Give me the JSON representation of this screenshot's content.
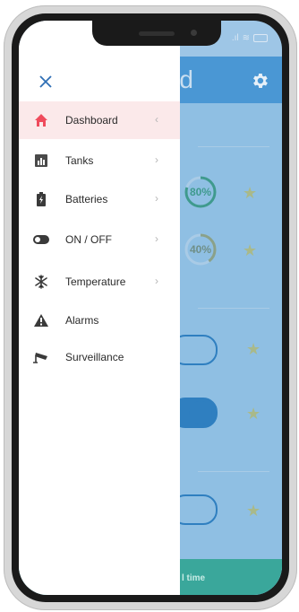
{
  "header": {
    "title_fragment": "rd"
  },
  "readings": [
    {
      "value_text": "80%",
      "percent": 80
    },
    {
      "value_text": "40%",
      "percent": 40
    }
  ],
  "toggles": [
    {
      "on": false
    },
    {
      "on": true
    },
    {
      "on": false
    }
  ],
  "bottom": {
    "text_fragment": "l time"
  },
  "drawer": {
    "close_icon": "close-icon",
    "items": [
      {
        "label": "Dashboard",
        "icon": "home-icon",
        "active": true,
        "chevron": "‹"
      },
      {
        "label": "Tanks",
        "icon": "bar-chart-icon",
        "chevron": "›"
      },
      {
        "label": "Batteries",
        "icon": "battery-icon",
        "chevron": "›"
      },
      {
        "label": "ON / OFF",
        "icon": "toggle-icon",
        "chevron": "›"
      },
      {
        "label": "Temperature",
        "icon": "snowflake-icon",
        "chevron": "›"
      },
      {
        "label": "Alarms",
        "icon": "warning-icon"
      },
      {
        "label": "Surveillance",
        "icon": "cctv-camera-icon"
      }
    ]
  },
  "colors": {
    "accent": "#ef4b5c",
    "header": "#4a97d4",
    "teal": "#3f9a8e"
  }
}
